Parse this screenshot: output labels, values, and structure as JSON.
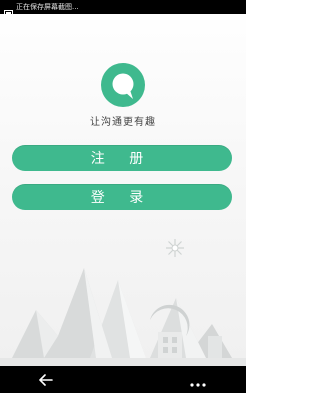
{
  "status_bar": {
    "notification_text": "正在保存屏幕截图..."
  },
  "app": {
    "slogan": "让沟通更有趣",
    "brand_color": "#3fb98e"
  },
  "actions": {
    "register_label": "注 册",
    "login_label": "登 录"
  },
  "navigation": {
    "back_icon": "back-arrow-icon",
    "more_icon": "more-dots-icon"
  }
}
